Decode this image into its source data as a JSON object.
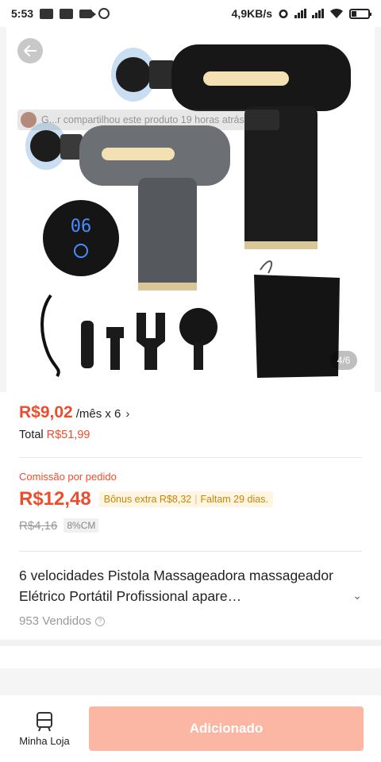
{
  "status_bar": {
    "time": "5:53",
    "network_speed": "4,9KB/s"
  },
  "hero": {
    "share_banner": "G...r compartilhou este produto 19 horas atrás",
    "photo_counter": "4/6",
    "device_display": "06"
  },
  "price": {
    "installment_price": "R$9,02",
    "installment_suffix": "/mês x 6",
    "total_label": "Total",
    "total_value": "R$51,99"
  },
  "commission": {
    "label": "Comissão por pedido",
    "value": "R$12,48",
    "bonus": "Bônus extra R$8,32",
    "remaining": "Faltam 29 dias.",
    "old_value": "R$4,16",
    "rate": "8%CM"
  },
  "product": {
    "title": "6 velocidades Pistola Massageadora massageador Elétrico Portátil Profissional apare…",
    "sold": "953 Vendidos"
  },
  "bottom_bar": {
    "shop_label": "Minha Loja",
    "add_button_label": "Adicionado"
  },
  "colors": {
    "accent": "#ee4d2d",
    "button_disabled": "#fbb7a3",
    "bonus_bg": "#fff5e0",
    "bonus_text": "#c8860a"
  }
}
